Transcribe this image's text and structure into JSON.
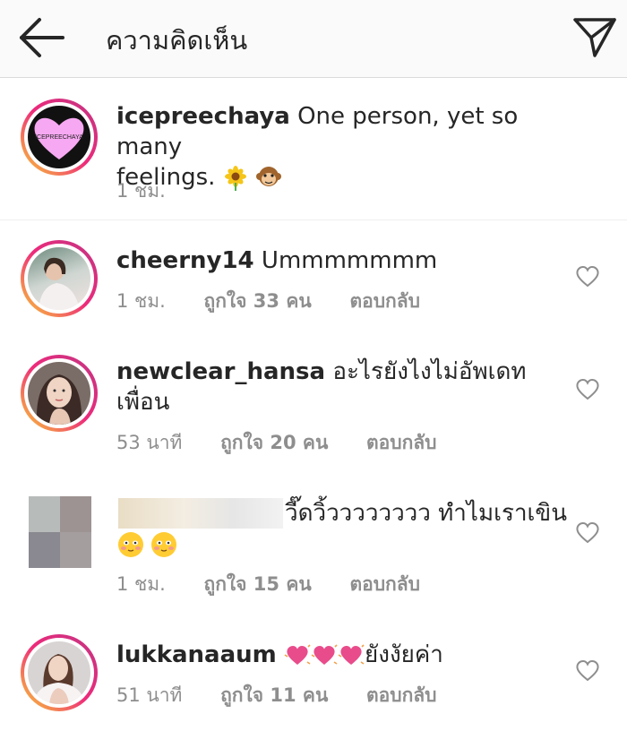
{
  "header": {
    "title": "ความคิดเห็น"
  },
  "caption": {
    "username": "icepreechaya",
    "avatar_text": "ICEPREECHAYA",
    "text": "One person, yet so many",
    "text2": "feelings.",
    "time": "1 ชม."
  },
  "comments": [
    {
      "username": "cheerny14",
      "text": "Ummmmmmm",
      "time": "1 ชม.",
      "likes": "ถูกใจ 33 คน",
      "reply": "ตอบกลับ"
    },
    {
      "username": "newclear_hansa",
      "text": "อะไรยังไงไม่อัพเดท",
      "text2": "เพื่อน",
      "time": "53 นาที",
      "likes": "ถูกใจ 20 คน",
      "reply": "ตอบกลับ"
    },
    {
      "username": "",
      "text": "วี๊ดวิ้วววววววว ทำไมเราเขิน",
      "time": "1 ชม.",
      "likes": "ถูกใจ 15 คน",
      "reply": "ตอบกลับ"
    },
    {
      "username": "lukkanaaum",
      "text": "ยังงัยค่า",
      "time": "51 นาที",
      "likes": "ถูกใจ 11 คน",
      "reply": "ตอบกลับ"
    }
  ],
  "icons": {
    "back": "arrow-left-icon",
    "send": "paper-plane-icon",
    "like": "heart-outline-icon",
    "sunflower": "sunflower-emoji",
    "monkey": "monkey-emoji",
    "blush": "blush-emoji",
    "hearts": "sparkling-heart-emoji"
  },
  "colors": {
    "ring_gradient": [
      "#f9ce34",
      "#ee2a7b",
      "#c13584"
    ],
    "secondary_text": "#8e8e8e",
    "header_bg": "#fafafa",
    "avatar_heart": "#f7a8f2"
  }
}
